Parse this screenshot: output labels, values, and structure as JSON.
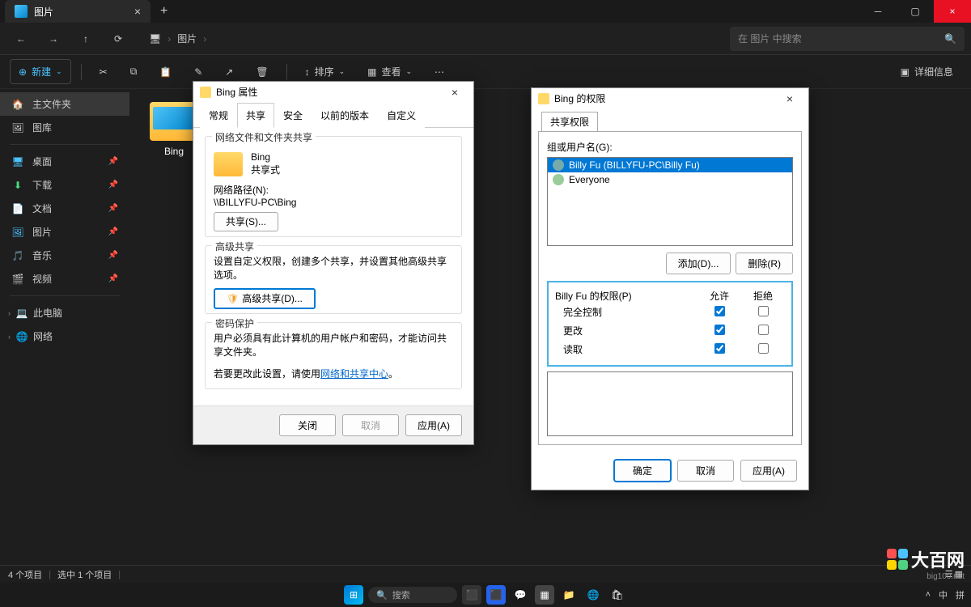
{
  "titlebar": {
    "tab_title": "图片"
  },
  "breadcrumb": {
    "root_icon": "monitor",
    "item": "图片"
  },
  "search": {
    "placeholder": "在 图片 中搜索"
  },
  "toolbar": {
    "new": "新建",
    "sort": "排序",
    "view": "查看",
    "details": "详细信息"
  },
  "sidebar": {
    "home": "主文件夹",
    "gallery": "图库",
    "desktop": "桌面",
    "downloads": "下载",
    "documents": "文档",
    "pictures": "图片",
    "music": "音乐",
    "videos": "视频",
    "thispc": "此电脑",
    "network": "网络"
  },
  "content": {
    "folder1": "Bing"
  },
  "status": {
    "count": "4 个项目",
    "selected": "选中 1 个项目"
  },
  "taskbar": {
    "search": "搜索",
    "tray_lang1": "中",
    "tray_lang2": "拼"
  },
  "watermark": {
    "name": "大百网",
    "sub": "big100.net"
  },
  "dlg1": {
    "title": "Bing 属性",
    "tabs": {
      "general": "常规",
      "sharing": "共享",
      "security": "安全",
      "prev": "以前的版本",
      "custom": "自定义"
    },
    "g1_title": "网络文件和文件夹共享",
    "folder_name": "Bing",
    "folder_status": "共享式",
    "netpath_label": "网络路径(N):",
    "netpath": "\\\\BILLYFU-PC\\Bing",
    "share_btn": "共享(S)...",
    "g2_title": "高级共享",
    "g2_text": "设置自定义权限，创建多个共享，并设置其他高级共享选项。",
    "adv_btn": "高级共享(D)...",
    "g3_title": "密码保护",
    "g3_text": "用户必须具有此计算机的用户帐户和密码，才能访问共享文件夹。",
    "g3_text2a": "若要更改此设置，请使用",
    "g3_link": "网络和共享中心",
    "g3_text2b": "。",
    "close": "关闭",
    "cancel": "取消",
    "apply": "应用(A)"
  },
  "dlg2": {
    "title": "Bing 的权限",
    "tab": "共享权限",
    "groups_label": "组或用户名(G):",
    "user1": "Billy Fu (BILLYFU-PC\\Billy Fu)",
    "user2": "Everyone",
    "add": "添加(D)...",
    "remove": "删除(R)",
    "perm_for": "Billy Fu 的权限(P)",
    "allow": "允许",
    "deny": "拒绝",
    "full": "完全控制",
    "change": "更改",
    "read": "读取",
    "ok": "确定",
    "cancel": "取消",
    "apply": "应用(A)"
  }
}
